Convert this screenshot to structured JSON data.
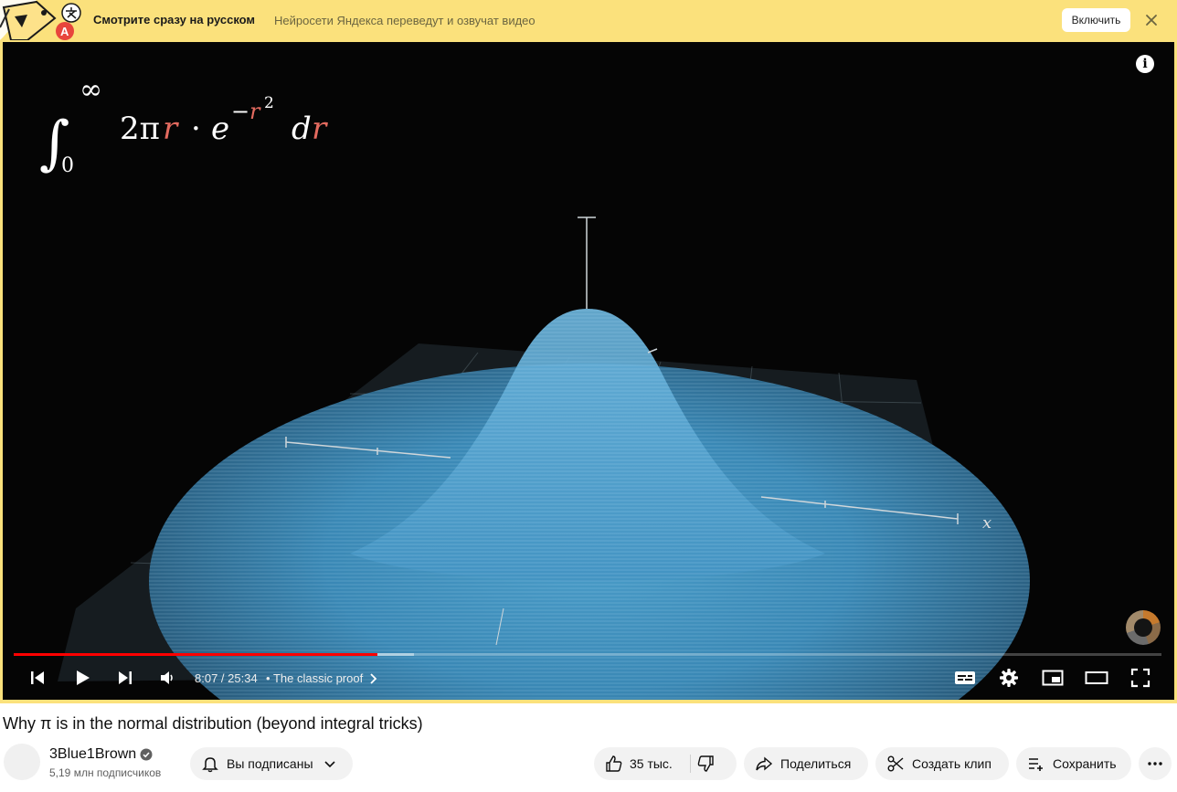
{
  "banner": {
    "title": "Смотрите сразу на русском",
    "subtitle": "Нейросети Яндекса переведут и озвучат видео",
    "enable_label": "Включить",
    "bg_color": "#fbe17c"
  },
  "player": {
    "formula_label": "∫₀^∞ 2πr · e^(−r²) dr",
    "axis_label": "x",
    "time_current": "8:07",
    "time_total": "25:34",
    "chapter": "The classic proof",
    "progress_fraction": 0.317,
    "buffered_fraction": 0.349,
    "info_glyph": "i",
    "icons": [
      "previous-icon",
      "play-icon",
      "next-icon",
      "volume-icon",
      "subtitles-icon",
      "settings-icon",
      "miniplayer-icon",
      "theater-mode-icon",
      "fullscreen-icon"
    ],
    "accent_color": "#ff0000"
  },
  "video": {
    "title": "Why π is in the normal distribution (beyond integral tricks)",
    "channel": "3Blue1Brown",
    "subscribers": "5,19 млн подписчиков"
  },
  "actions": {
    "subscribed_label": "Вы подписаны",
    "likes": "35 тыс.",
    "share_label": "Поделиться",
    "clip_label": "Создать клип",
    "save_label": "Сохранить"
  }
}
